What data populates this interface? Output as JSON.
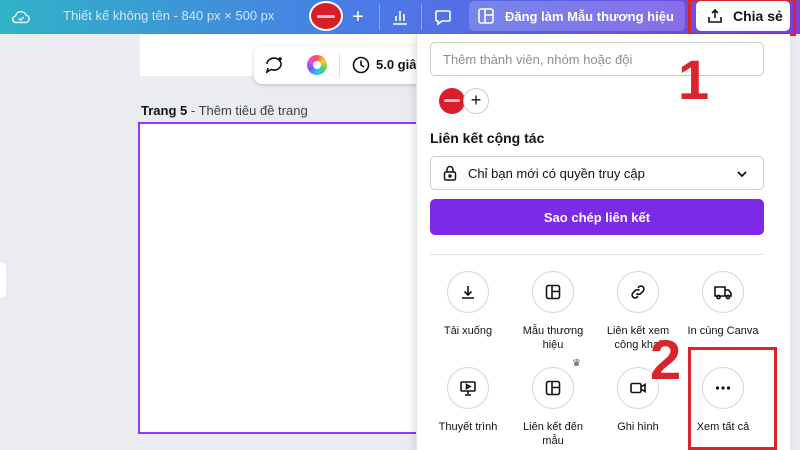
{
  "topbar": {
    "title": "Thiết kế không tên - 840 px × 500 px",
    "brand_button": "Đăng làm Mẫu thương hiệu",
    "share_button": "Chia sẻ",
    "cloud_icon": "cloud-check-icon",
    "gradient_colors": [
      "#2fb3c6",
      "#4a7be6",
      "#7b3fe4"
    ]
  },
  "canvas": {
    "toolbar_duration": "5.0 giâ",
    "page_label_bold": "Trang 5",
    "page_label_rest": " - Thêm tiêu đề trang",
    "selection_color": "#8b3dff"
  },
  "share_panel": {
    "member_placeholder": "Thêm thành viên, nhóm hoặc đội",
    "collab_link_label": "Liên kết cộng tác",
    "access_value": "Chỉ bạn mới có quyền truy cập",
    "copy_link_button": "Sao chép liên kết",
    "accent_color": "#7d2ae8",
    "options_row1": [
      {
        "label": "Tải xuống",
        "icon": "download-icon"
      },
      {
        "label": "Mẫu thương hiệu",
        "icon": "template-icon"
      },
      {
        "label": "Liên kết xem công khai",
        "icon": "link-icon"
      },
      {
        "label": "In cùng Canva",
        "icon": "truck-icon"
      }
    ],
    "options_row2": [
      {
        "label": "Thuyết trình",
        "icon": "presentation-icon"
      },
      {
        "label": "Liên kết đến mẫu",
        "icon": "template-link-icon"
      },
      {
        "label": "Ghi hình",
        "icon": "video-camera-icon"
      },
      {
        "label": "Xem tất cả",
        "icon": "more-dots-icon"
      }
    ]
  },
  "annotations": {
    "step1": "1",
    "step2": "2",
    "color": "#d9242a"
  }
}
